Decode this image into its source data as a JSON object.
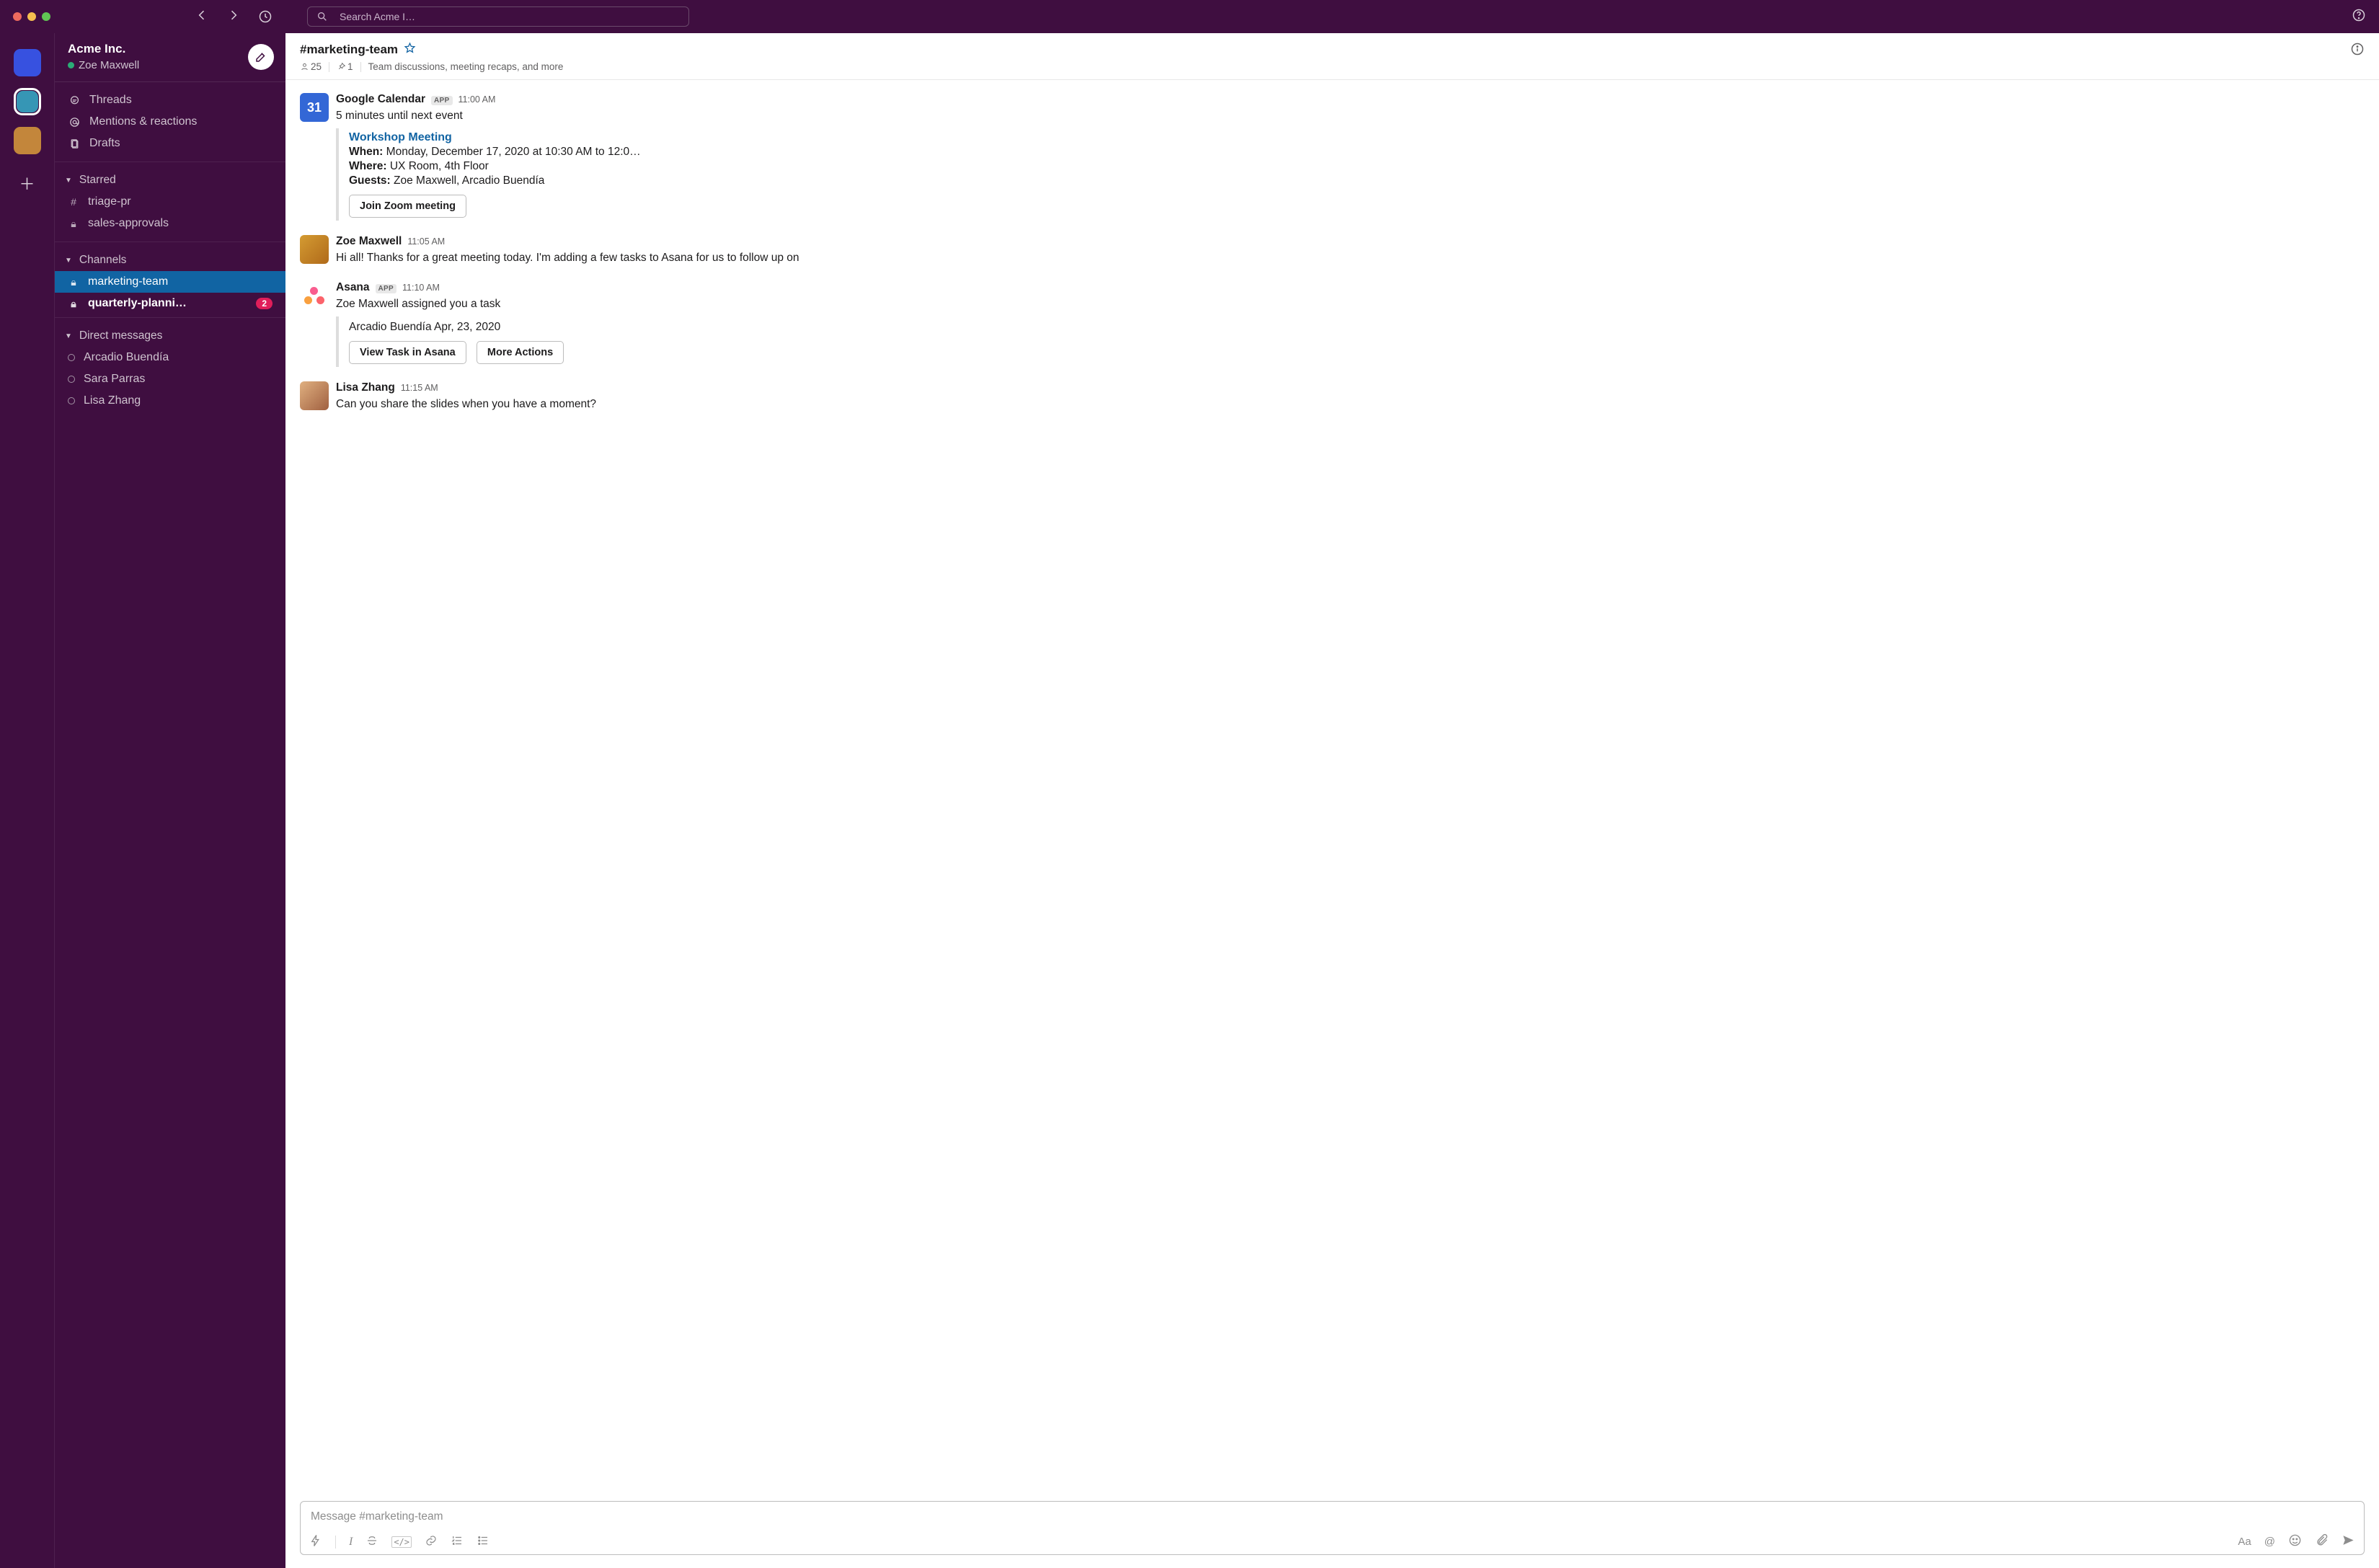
{
  "topbar": {
    "search_placeholder": "Search Acme I…"
  },
  "rail": {
    "workspaces": [
      {
        "color": "#3751e0"
      },
      {
        "color": "#3696b5",
        "selected": true
      },
      {
        "color": "#c3863b"
      }
    ]
  },
  "sidebar": {
    "workspace_name": "Acme Inc.",
    "user_name": "Zoe Maxwell",
    "primary": {
      "threads": "Threads",
      "mentions": "Mentions & reactions",
      "drafts": "Drafts"
    },
    "starred": {
      "label": "Starred",
      "items": [
        {
          "prefix": "#",
          "label": "triage-pr"
        },
        {
          "prefix": "lock",
          "label": "sales-approvals"
        }
      ]
    },
    "channels": {
      "label": "Channels",
      "items": [
        {
          "prefix": "lock",
          "label": "marketing-team",
          "active": true
        },
        {
          "prefix": "lock",
          "label": "quarterly-planni…",
          "bold": true,
          "badge": "2"
        }
      ]
    },
    "dms": {
      "label": "Direct messages",
      "items": [
        {
          "label": "Arcadio Buendía"
        },
        {
          "label": "Sara Parras"
        },
        {
          "label": "Lisa Zhang"
        }
      ]
    }
  },
  "header": {
    "channel_name": "#marketing-team",
    "members": "25",
    "pins": "1",
    "topic": "Team discussions, meeting recaps, and more"
  },
  "messages": {
    "m0": {
      "sender": "Google Calendar",
      "app_badge": "APP",
      "ts": "11:00 AM",
      "avatar_text": "31",
      "text": "5 minutes until next event",
      "attach_title": "Workshop Meeting",
      "when_label": "When:",
      "when": "Monday, December 17, 2020 at 10:30 AM to 12:0…",
      "where_label": "Where:",
      "where": "UX Room, 4th Floor",
      "guests_label": "Guests:",
      "guests": "Zoe Maxwell, Arcadio Buendía",
      "btn": "Join Zoom meeting"
    },
    "m1": {
      "sender": "Zoe Maxwell",
      "ts": "11:05 AM",
      "text": "Hi all! Thanks for a great meeting today. I'm adding a few tasks to Asana for us to follow up on"
    },
    "m2": {
      "sender": "Asana",
      "app_badge": "APP",
      "ts": "11:10 AM",
      "text": "Zoe Maxwell assigned you a task",
      "attach_line": "Arcadio Buendía Apr, 23, 2020",
      "btn1": "View Task in Asana",
      "btn2": "More Actions"
    },
    "m3": {
      "sender": "Lisa Zhang",
      "ts": "11:15 AM",
      "text": "Can you share the slides when you have a moment?"
    }
  },
  "composer": {
    "placeholder": "Message #marketing-team"
  }
}
